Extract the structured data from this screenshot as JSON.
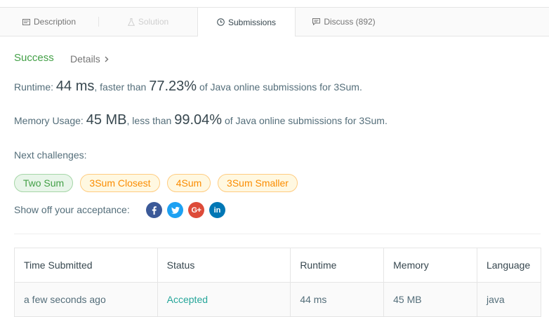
{
  "tabs": [
    {
      "label": "Description",
      "icon": "description-icon"
    },
    {
      "label": "Solution",
      "icon": "flask-icon"
    },
    {
      "label": "Submissions",
      "icon": "clock-icon"
    },
    {
      "label": "Discuss (892)",
      "icon": "comment-icon"
    }
  ],
  "result": {
    "status": "Success",
    "details_label": "Details"
  },
  "runtime": {
    "label": "Runtime:",
    "value": "44 ms",
    "compare": ", faster than",
    "percent": "77.23%",
    "suffix": "of Java online submissions for 3Sum."
  },
  "memory": {
    "label": "Memory Usage:",
    "value": "45 MB",
    "compare": ", less than",
    "percent": "99.04%",
    "suffix": "of Java online submissions for 3Sum."
  },
  "next": {
    "label": "Next challenges:",
    "challenges": [
      {
        "label": "Two Sum",
        "difficulty": "easy"
      },
      {
        "label": "3Sum Closest",
        "difficulty": "medium"
      },
      {
        "label": "4Sum",
        "difficulty": "medium"
      },
      {
        "label": "3Sum Smaller",
        "difficulty": "medium"
      }
    ]
  },
  "share": {
    "label": "Show off your acceptance:",
    "icons": [
      "facebook-icon",
      "twitter-icon",
      "google-plus-icon",
      "linkedin-icon"
    ]
  },
  "table": {
    "headers": [
      "Time Submitted",
      "Status",
      "Runtime",
      "Memory",
      "Language"
    ],
    "rows": [
      [
        "a few seconds ago",
        "Accepted",
        "44 ms",
        "45 MB",
        "java"
      ]
    ]
  },
  "colors": {
    "success": "#43a047",
    "accepted": "#26a69a",
    "medium": "#fb8c00"
  }
}
